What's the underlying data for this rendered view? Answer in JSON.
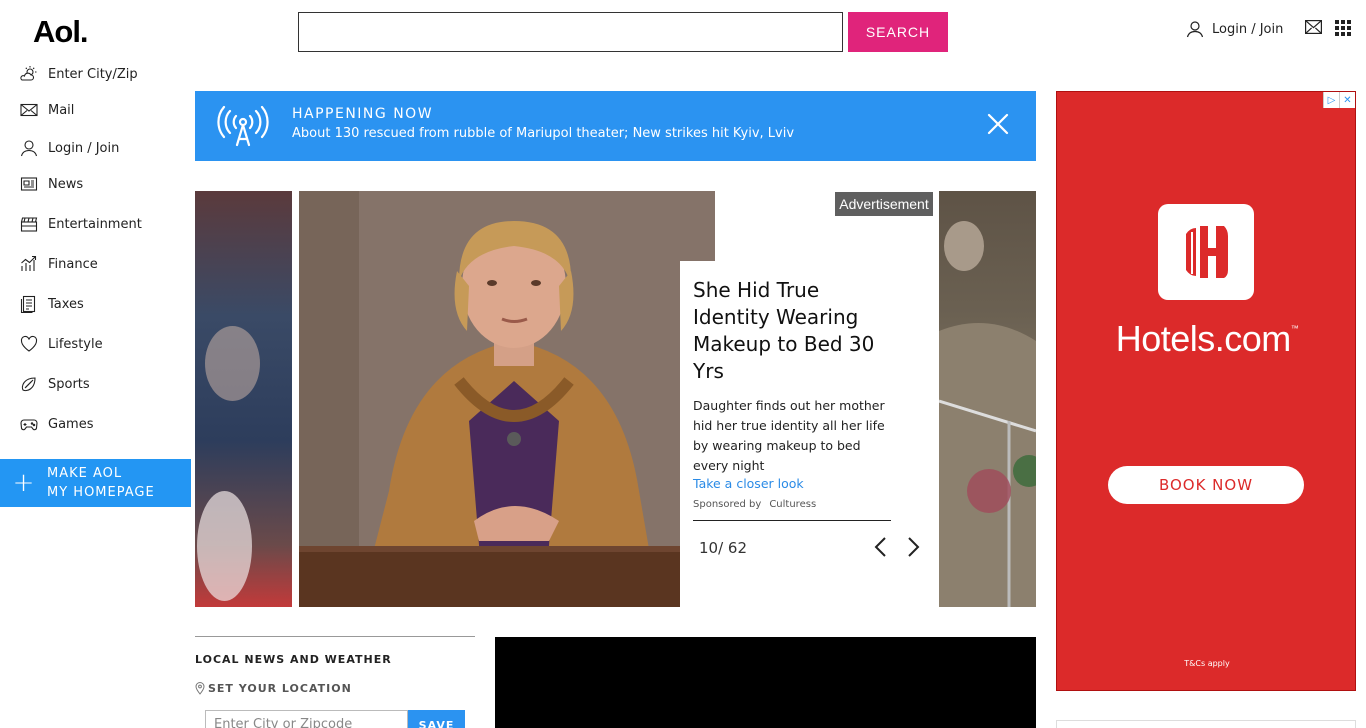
{
  "header": {
    "logo": "Aol.",
    "search_value": "",
    "search_button": "SEARCH",
    "login": "Login / Join"
  },
  "sidebar": {
    "items": [
      {
        "label": "Enter City/Zip",
        "icon": "weather-icon"
      },
      {
        "label": "Mail",
        "icon": "mail-icon"
      },
      {
        "label": "Login / Join",
        "icon": "user-icon"
      },
      {
        "label": "News",
        "icon": "news-icon"
      },
      {
        "label": "Entertainment",
        "icon": "clapperboard-icon"
      },
      {
        "label": "Finance",
        "icon": "finance-chart-icon"
      },
      {
        "label": "Taxes",
        "icon": "taxes-document-icon"
      },
      {
        "label": "Lifestyle",
        "icon": "heart-icon"
      },
      {
        "label": "Sports",
        "icon": "football-icon"
      },
      {
        "label": "Games",
        "icon": "gamepad-icon"
      }
    ],
    "make_homepage_line1": "MAKE AOL",
    "make_homepage_line2": "MY HOMEPAGE"
  },
  "happening": {
    "title": "HAPPENING NOW",
    "text": "About 130 rescued from rubble of Mariupol theater; New strikes hit Kyiv, Lviv"
  },
  "carousel": {
    "ad_label": "Advertisement",
    "title": "She Hid True Identity Wearing Makeup to Bed 30 Yrs",
    "description": "Daughter finds out her mother hid her true identity all her life by wearing makeup to bed every night",
    "link": "Take a closer look",
    "sponsored_by": "Sponsored by",
    "sponsor": "Culturess",
    "counter": "10/ 62"
  },
  "local": {
    "title": "LOCAL NEWS AND WEATHER",
    "set_location": "SET YOUR LOCATION",
    "input_placeholder": "Enter City or Zipcode",
    "save": "SAVE"
  },
  "right_ad": {
    "brand": "Hotels.com",
    "trademark": "™",
    "book_now": "BOOK NOW",
    "tcs": "T&Cs apply",
    "brand_color": "#dc2a2a"
  },
  "colors": {
    "accent_pink": "#e0247b",
    "accent_blue": "#2b93f1"
  }
}
